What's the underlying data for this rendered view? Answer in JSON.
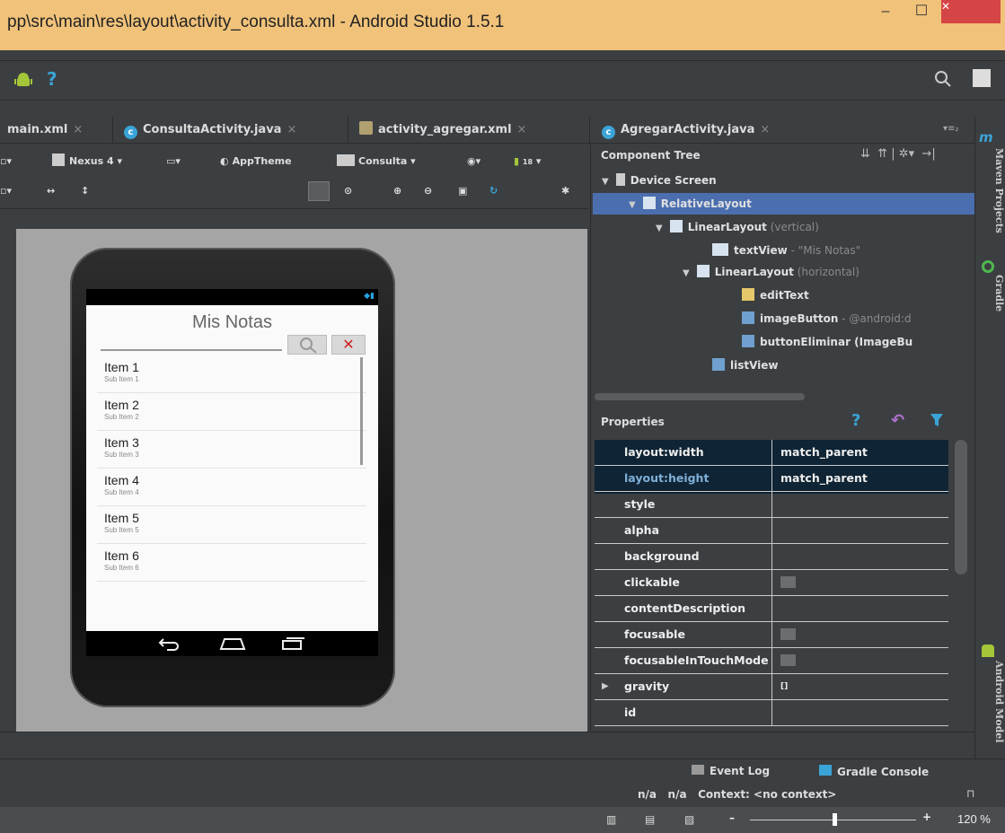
{
  "window": {
    "title": "pp\\src\\main\\res\\layout\\activity_consulta.xml - Android Studio 1.5.1",
    "minimize": "–",
    "maximize": "☐",
    "close": "✕"
  },
  "toolbar": {
    "help": "?"
  },
  "tabs": [
    {
      "label": "main.xml",
      "close": "×"
    },
    {
      "label": "ConsultaActivity.java",
      "close": "×",
      "icon": "c"
    },
    {
      "label": "activity_agregar.xml",
      "close": "×"
    },
    {
      "label": "AgregarActivity.java",
      "close": "×",
      "icon": "c"
    }
  ],
  "tab_overflow": "▾≡₂",
  "designer": {
    "device": "Nexus 4",
    "theme": "AppTheme",
    "activity": "Consulta",
    "api": "18"
  },
  "phone": {
    "app_title": "Mis Notas",
    "delete_glyph": "✕",
    "items": [
      {
        "title": "Item 1",
        "sub": "Sub Item 1"
      },
      {
        "title": "Item 2",
        "sub": "Sub Item 2"
      },
      {
        "title": "Item 3",
        "sub": "Sub Item 3"
      },
      {
        "title": "Item 4",
        "sub": "Sub Item 4"
      },
      {
        "title": "Item 5",
        "sub": "Sub Item 5"
      },
      {
        "title": "Item 6",
        "sub": "Sub Item 6"
      }
    ]
  },
  "component_tree": {
    "header": "Component Tree",
    "nodes": [
      {
        "label": "Device Screen",
        "hint": ""
      },
      {
        "label": "RelativeLayout",
        "hint": ""
      },
      {
        "label": "LinearLayout",
        "hint": " (vertical)"
      },
      {
        "label": "textView",
        "hint": " - \"Mis Notas\""
      },
      {
        "label": "LinearLayout",
        "hint": " (horizontal)"
      },
      {
        "label": "editText",
        "hint": ""
      },
      {
        "label": "imageButton",
        "hint": " - @android:d"
      },
      {
        "label": "buttonEliminar (ImageBu",
        "hint": ""
      },
      {
        "label": "listView",
        "hint": ""
      }
    ]
  },
  "properties": {
    "header": "Properties",
    "rows": [
      {
        "key": "layout:width",
        "value": "match_parent"
      },
      {
        "key": "layout:height",
        "value": "match_parent"
      },
      {
        "key": "style",
        "value": ""
      },
      {
        "key": "alpha",
        "value": ""
      },
      {
        "key": "background",
        "value": ""
      },
      {
        "key": "clickable",
        "value": ""
      },
      {
        "key": "contentDescription",
        "value": ""
      },
      {
        "key": "focusable",
        "value": ""
      },
      {
        "key": "focusableInTouchMode",
        "value": ""
      },
      {
        "key": "gravity",
        "value": "[]"
      },
      {
        "key": "id",
        "value": ""
      }
    ]
  },
  "side_tabs": {
    "maven": "Maven Projects",
    "gradle": "Gradle",
    "android_model": "Android Model"
  },
  "bottom": {
    "event_log": "Event Log",
    "gradle_console": "Gradle Console",
    "status": "n/a   n/a   Context: <no context>"
  },
  "zoom": {
    "minus": "–",
    "plus": "+",
    "value": "120 %"
  },
  "colors": {
    "title_bar": "#f0c27a",
    "ide_dark": "#3c3f41",
    "selection": "#4b6eaf",
    "canvas": "#a5a5a5",
    "close_red": "#d64545",
    "delete_red": "#d02020"
  }
}
